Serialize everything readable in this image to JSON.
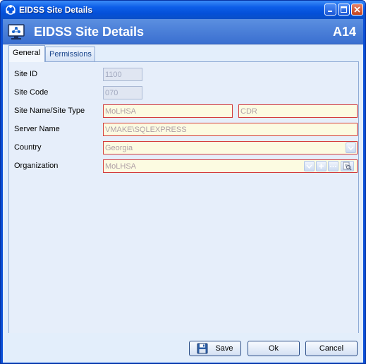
{
  "window": {
    "title": "EIDSS Site Details"
  },
  "header": {
    "title": "EIDSS Site Details",
    "code": "A14"
  },
  "tabs": [
    {
      "label": "General",
      "active": true
    },
    {
      "label": "Permissions",
      "active": false
    }
  ],
  "form": {
    "site_id": {
      "label": "Site ID",
      "value": "1100"
    },
    "site_code": {
      "label": "Site Code",
      "value": "070"
    },
    "site_name_type": {
      "label": "Site Name/Site Type",
      "name_value": "MoLHSA",
      "type_value": "CDR"
    },
    "server_name": {
      "label": "Server Name",
      "value": "VMAKE\\SQLEXPRESS"
    },
    "country": {
      "label": "Country",
      "value": "Georgia"
    },
    "organization": {
      "label": "Organization",
      "value": "MoLHSA"
    }
  },
  "buttons": {
    "save": "Save",
    "ok": "Ok",
    "cancel": "Cancel"
  },
  "colors": {
    "titlebar": "#0d5ee8",
    "header": "#4a7fd8",
    "client_bg": "#e3eefb",
    "required_border": "#d33b3b",
    "required_bg": "#fcfbe1"
  }
}
